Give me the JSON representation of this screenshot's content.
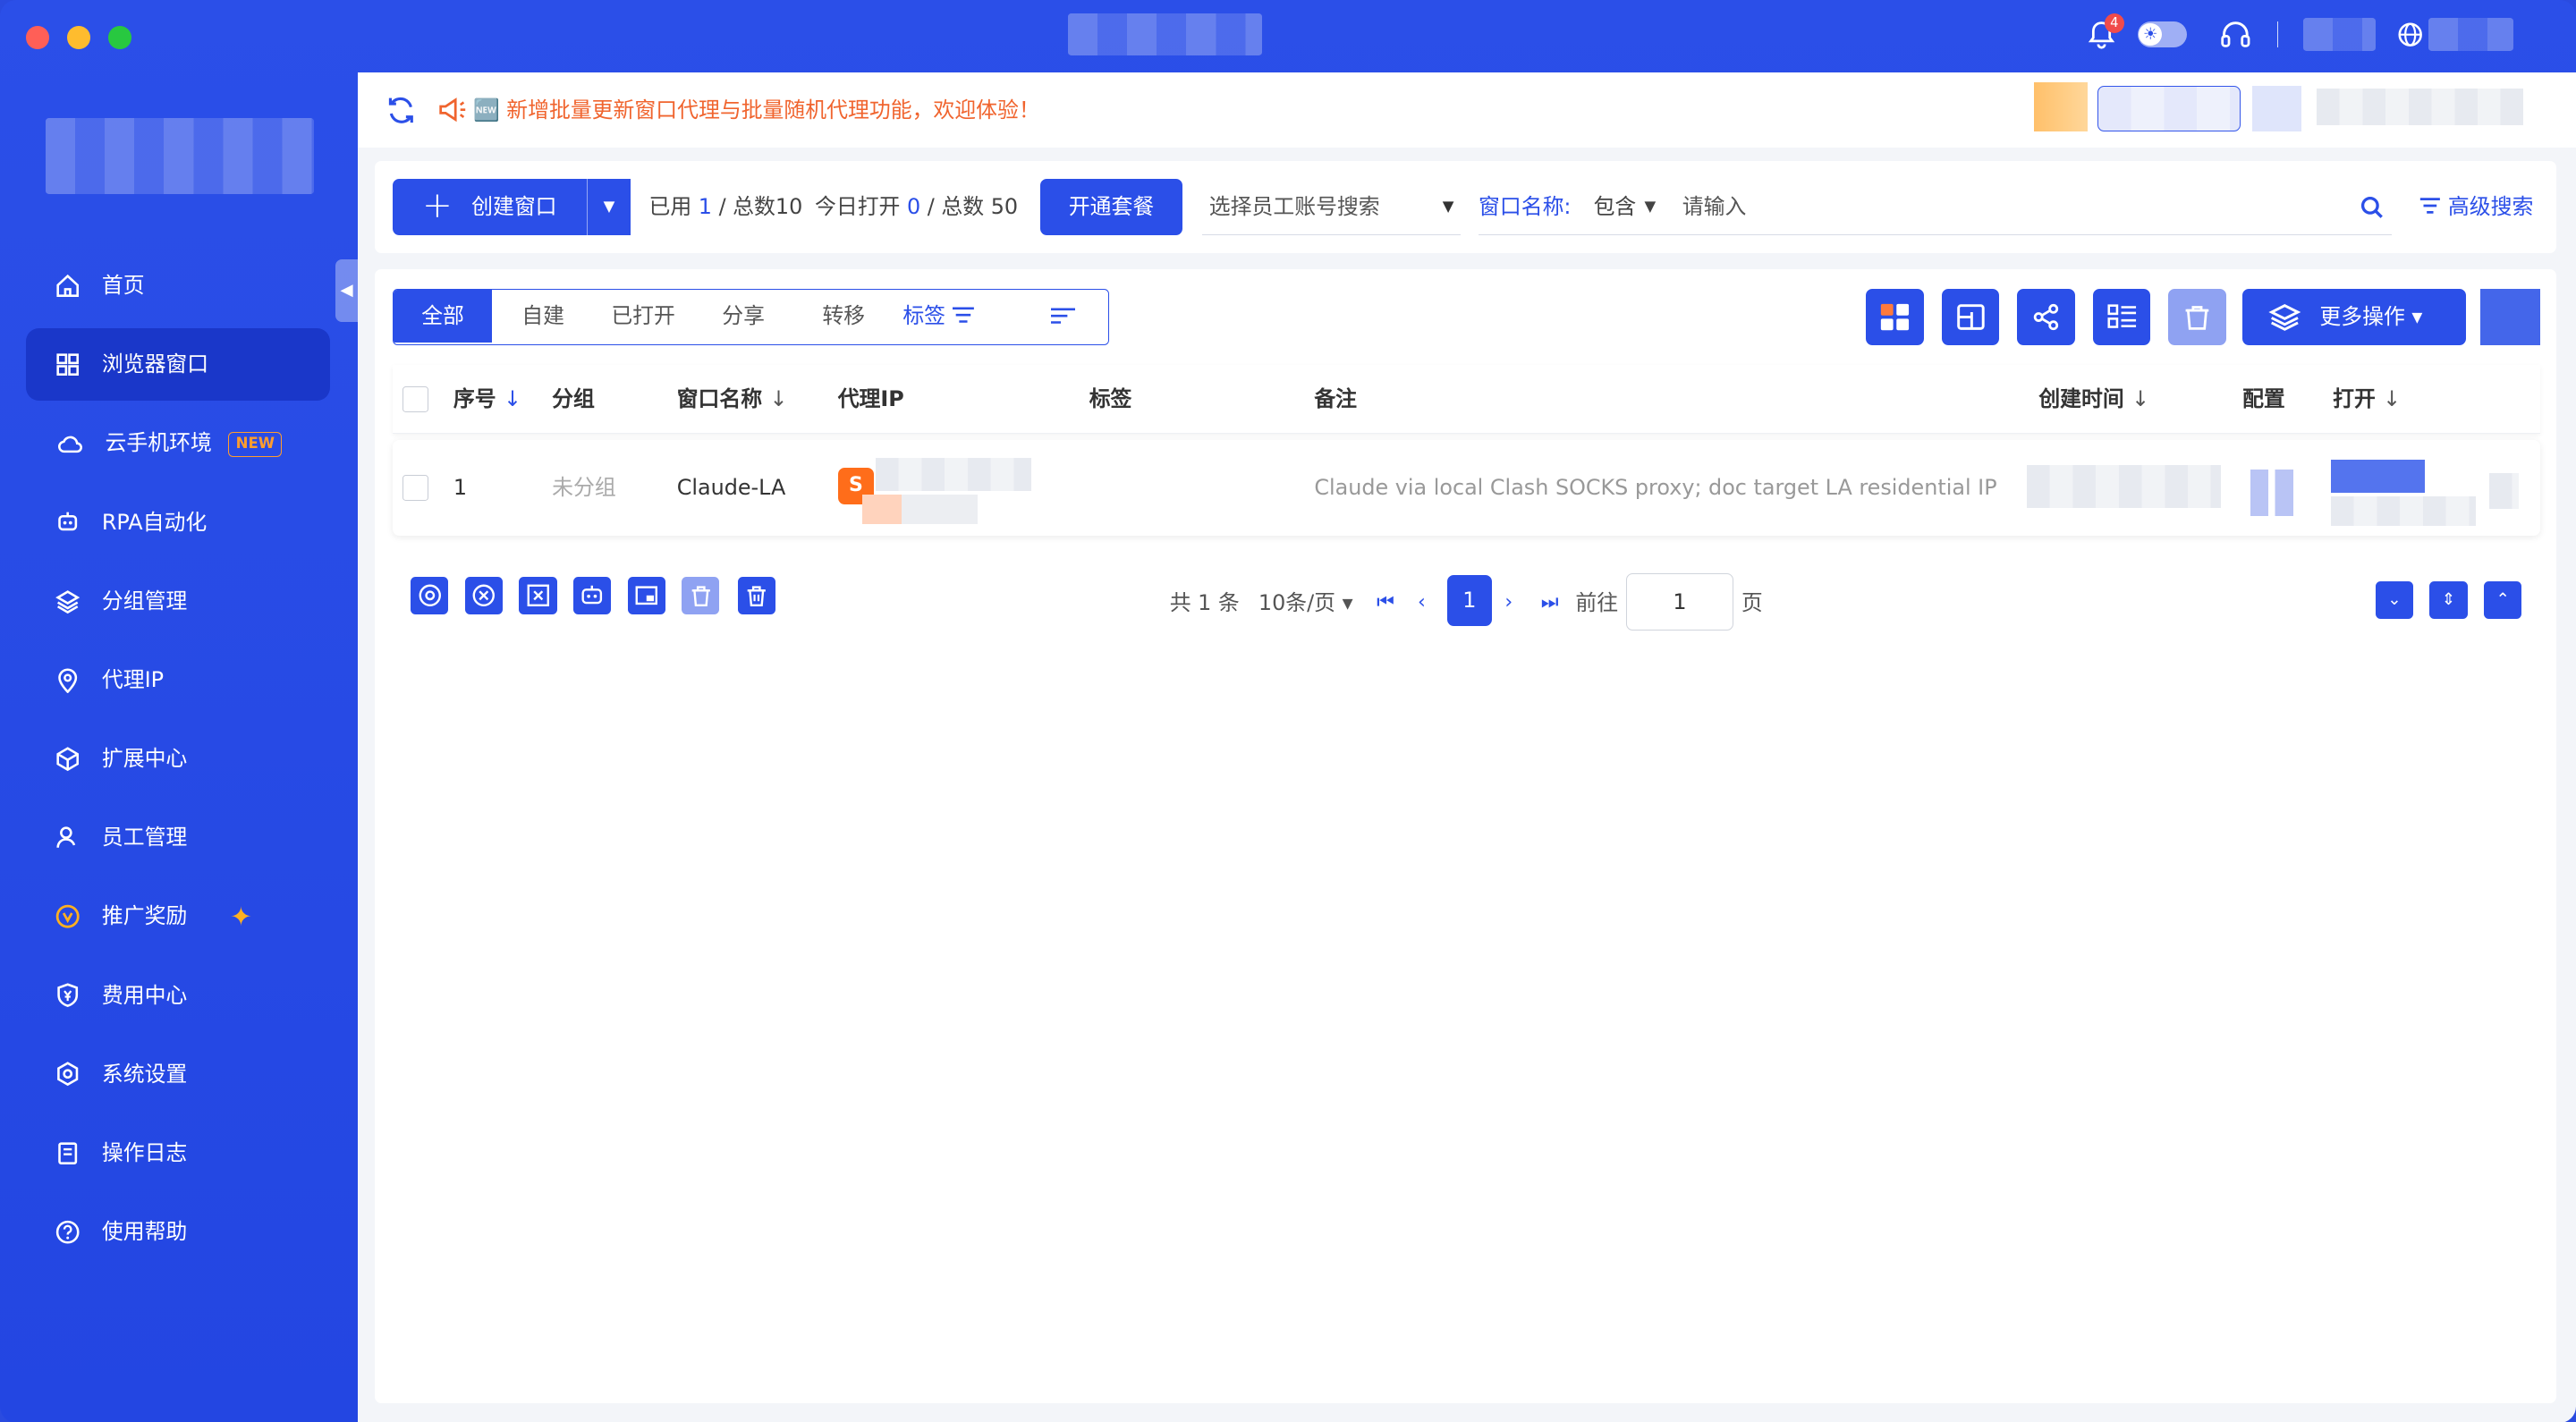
{
  "titlebar": {
    "notification_count": "4"
  },
  "sidebar": {
    "items": [
      {
        "label": "首页",
        "icon": "home-icon"
      },
      {
        "label": "浏览器窗口",
        "icon": "grid-icon",
        "active": true
      },
      {
        "label": "云手机环境",
        "icon": "cloud-phone-icon",
        "tag": "NEW"
      },
      {
        "label": "RPA自动化",
        "icon": "robot-icon"
      },
      {
        "label": "分组管理",
        "icon": "layers-icon"
      },
      {
        "label": "代理IP",
        "icon": "location-pin-icon"
      },
      {
        "label": "扩展中心",
        "icon": "cube-icon"
      },
      {
        "label": "员工管理",
        "icon": "user-icon"
      },
      {
        "label": "推广奖励",
        "icon": "reward-icon"
      },
      {
        "label": "费用中心",
        "icon": "shield-yen-icon"
      },
      {
        "label": "系统设置",
        "icon": "settings-icon"
      },
      {
        "label": "操作日志",
        "icon": "log-icon"
      },
      {
        "label": "使用帮助",
        "icon": "help-icon"
      }
    ]
  },
  "notice": {
    "text": "🆕 新增批量更新窗口代理与批量随机代理功能，欢迎体验！",
    "color": "#f0642e"
  },
  "toolbar": {
    "create_label": "创建窗口",
    "used_prefix": "已用",
    "used_value": "1",
    "used_total": "/ 总数10",
    "opened_prefix": "今日打开",
    "opened_value": "0",
    "opened_total": "/ 总数 50",
    "open_package_label": "开通套餐",
    "staff_search_placeholder": "选择员工账号搜索",
    "name_filter_key": "窗口名称:",
    "name_filter_mode": "包含",
    "name_filter_placeholder": "请输入",
    "advanced_search_label": "高级搜索"
  },
  "tabs": [
    "全部",
    "自建",
    "已打开",
    "分享",
    "转移",
    "标签"
  ],
  "more_actions_label": "更多操作",
  "table": {
    "headers": [
      "序号",
      "分组",
      "窗口名称",
      "代理IP",
      "标签",
      "备注",
      "创建时间",
      "配置",
      "打开"
    ],
    "rows": [
      {
        "index": "1",
        "group": "未分组",
        "name": "Claude-LA",
        "proxy_badge": "S",
        "tags": "",
        "note": "Claude via local Clash SOCKS proxy; doc target LA residential IP"
      }
    ]
  },
  "pagination": {
    "total": "共 1 条",
    "page_size": "10条/页",
    "current": "1",
    "goto_label": "前往",
    "goto_value": "1",
    "page_suffix": "页"
  },
  "colors": {
    "primary": "#2b4fe8",
    "sidebar_active": "#1a37c9",
    "accent_orange": "#ff9d2e"
  }
}
